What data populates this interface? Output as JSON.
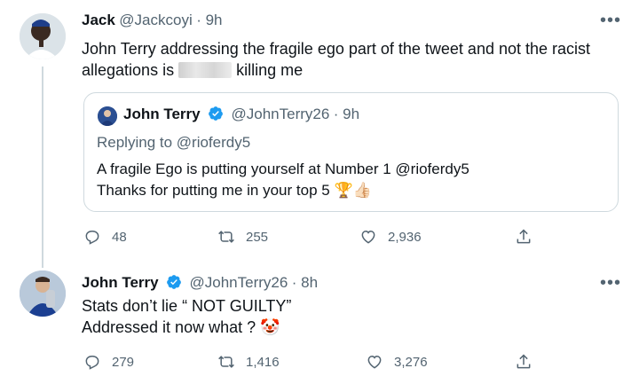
{
  "tweet1": {
    "name": "Jack",
    "handle": "@Jackcoyi",
    "time": "· 9h",
    "text_part1": "John Terry addressing the fragile ego part of the tweet and not the racist",
    "text_part2a": "allegations is",
    "text_part2b": "killing me",
    "quoted": {
      "name": "John Terry",
      "handle": "@JohnTerry26",
      "time": "· 9h",
      "replying_to": "Replying to @rioferdy5",
      "line1": "A fragile Ego is putting yourself at Number 1 @rioferdy5",
      "line2": "Thanks for putting me in your top 5",
      "emoji": "🏆👍🏻"
    },
    "actions": {
      "replies": "48",
      "retweets": "255",
      "likes": "2,936"
    }
  },
  "tweet2": {
    "name": "John Terry",
    "handle": "@JohnTerry26",
    "time": "· 8h",
    "line1": "Stats don’t lie “ NOT GUILTY”",
    "line2": "Addressed it now what ?",
    "emoji": "🤡",
    "actions": {
      "replies": "279",
      "retweets": "1,416",
      "likes": "3,276"
    }
  },
  "colors": {
    "verified": "#1d9bf0",
    "muted": "#536471",
    "border": "#cfd9de"
  },
  "icons": [
    "more-icon",
    "verified-icon",
    "reply-icon",
    "retweet-icon",
    "like-icon",
    "share-icon"
  ]
}
